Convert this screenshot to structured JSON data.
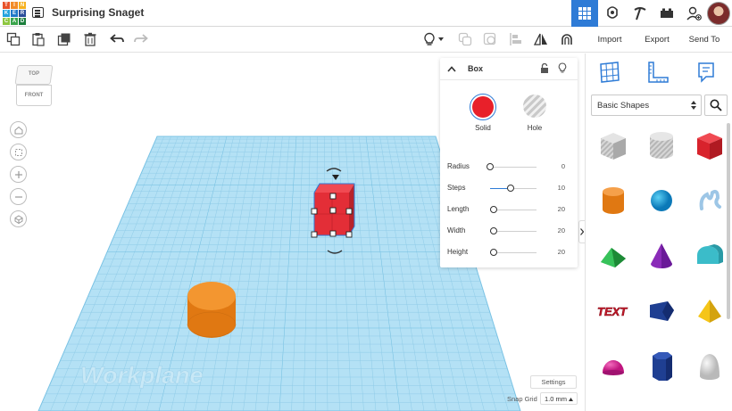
{
  "app": {
    "logo_letters": [
      "T",
      "I",
      "N",
      "K",
      "E",
      "R",
      "C",
      "A",
      "D"
    ],
    "logo_colors": [
      "#e8532b",
      "#f28c28",
      "#f6b221",
      "#23a3dd",
      "#1f77c9",
      "#2c4f9b",
      "#8dc63f",
      "#3aa54c",
      "#1b7e3c"
    ],
    "title": "Surprising Snaget"
  },
  "topbar": {
    "views": [
      {
        "name": "3d-design",
        "active": true
      },
      {
        "name": "circuits",
        "active": false
      },
      {
        "name": "codeblocks",
        "active": false
      },
      {
        "name": "lego-bricks",
        "active": false
      }
    ]
  },
  "actions": {
    "import_label": "Import",
    "export_label": "Export",
    "send_to_label": "Send To"
  },
  "viewcube": {
    "top_label": "TOP",
    "front_label": "FRONT"
  },
  "inspector": {
    "title": "Box",
    "solid_label": "Solid",
    "hole_label": "Hole",
    "solid_color": "#e8202a",
    "properties": [
      {
        "label": "Radius",
        "value": "0",
        "level": 0
      },
      {
        "label": "Steps",
        "value": "10",
        "level": 0.45
      },
      {
        "label": "Length",
        "value": "20",
        "level": 0.08
      },
      {
        "label": "Width",
        "value": "20",
        "level": 0.08
      },
      {
        "label": "Height",
        "value": "20",
        "level": 0.08
      }
    ]
  },
  "workplane": {
    "label": "Workplane",
    "settings_label": "Settings",
    "snap_grid_label": "Snap Grid",
    "snap_grid_value": "1.0 mm"
  },
  "shapes_panel": {
    "category": "Basic Shapes",
    "shapes": [
      "box-hole",
      "cylinder-hole",
      "box",
      "cylinder",
      "sphere",
      "scribble",
      "roof",
      "cone",
      "round-roof",
      "text",
      "polygon",
      "pyramid",
      "half-sphere",
      "hexagonal-prism",
      "paraboloid"
    ]
  },
  "colors": {
    "accent": "#2e7bd6",
    "workplane": "#a8dbf1",
    "box": "#e8323a",
    "cylinder": "#f08a1f"
  }
}
